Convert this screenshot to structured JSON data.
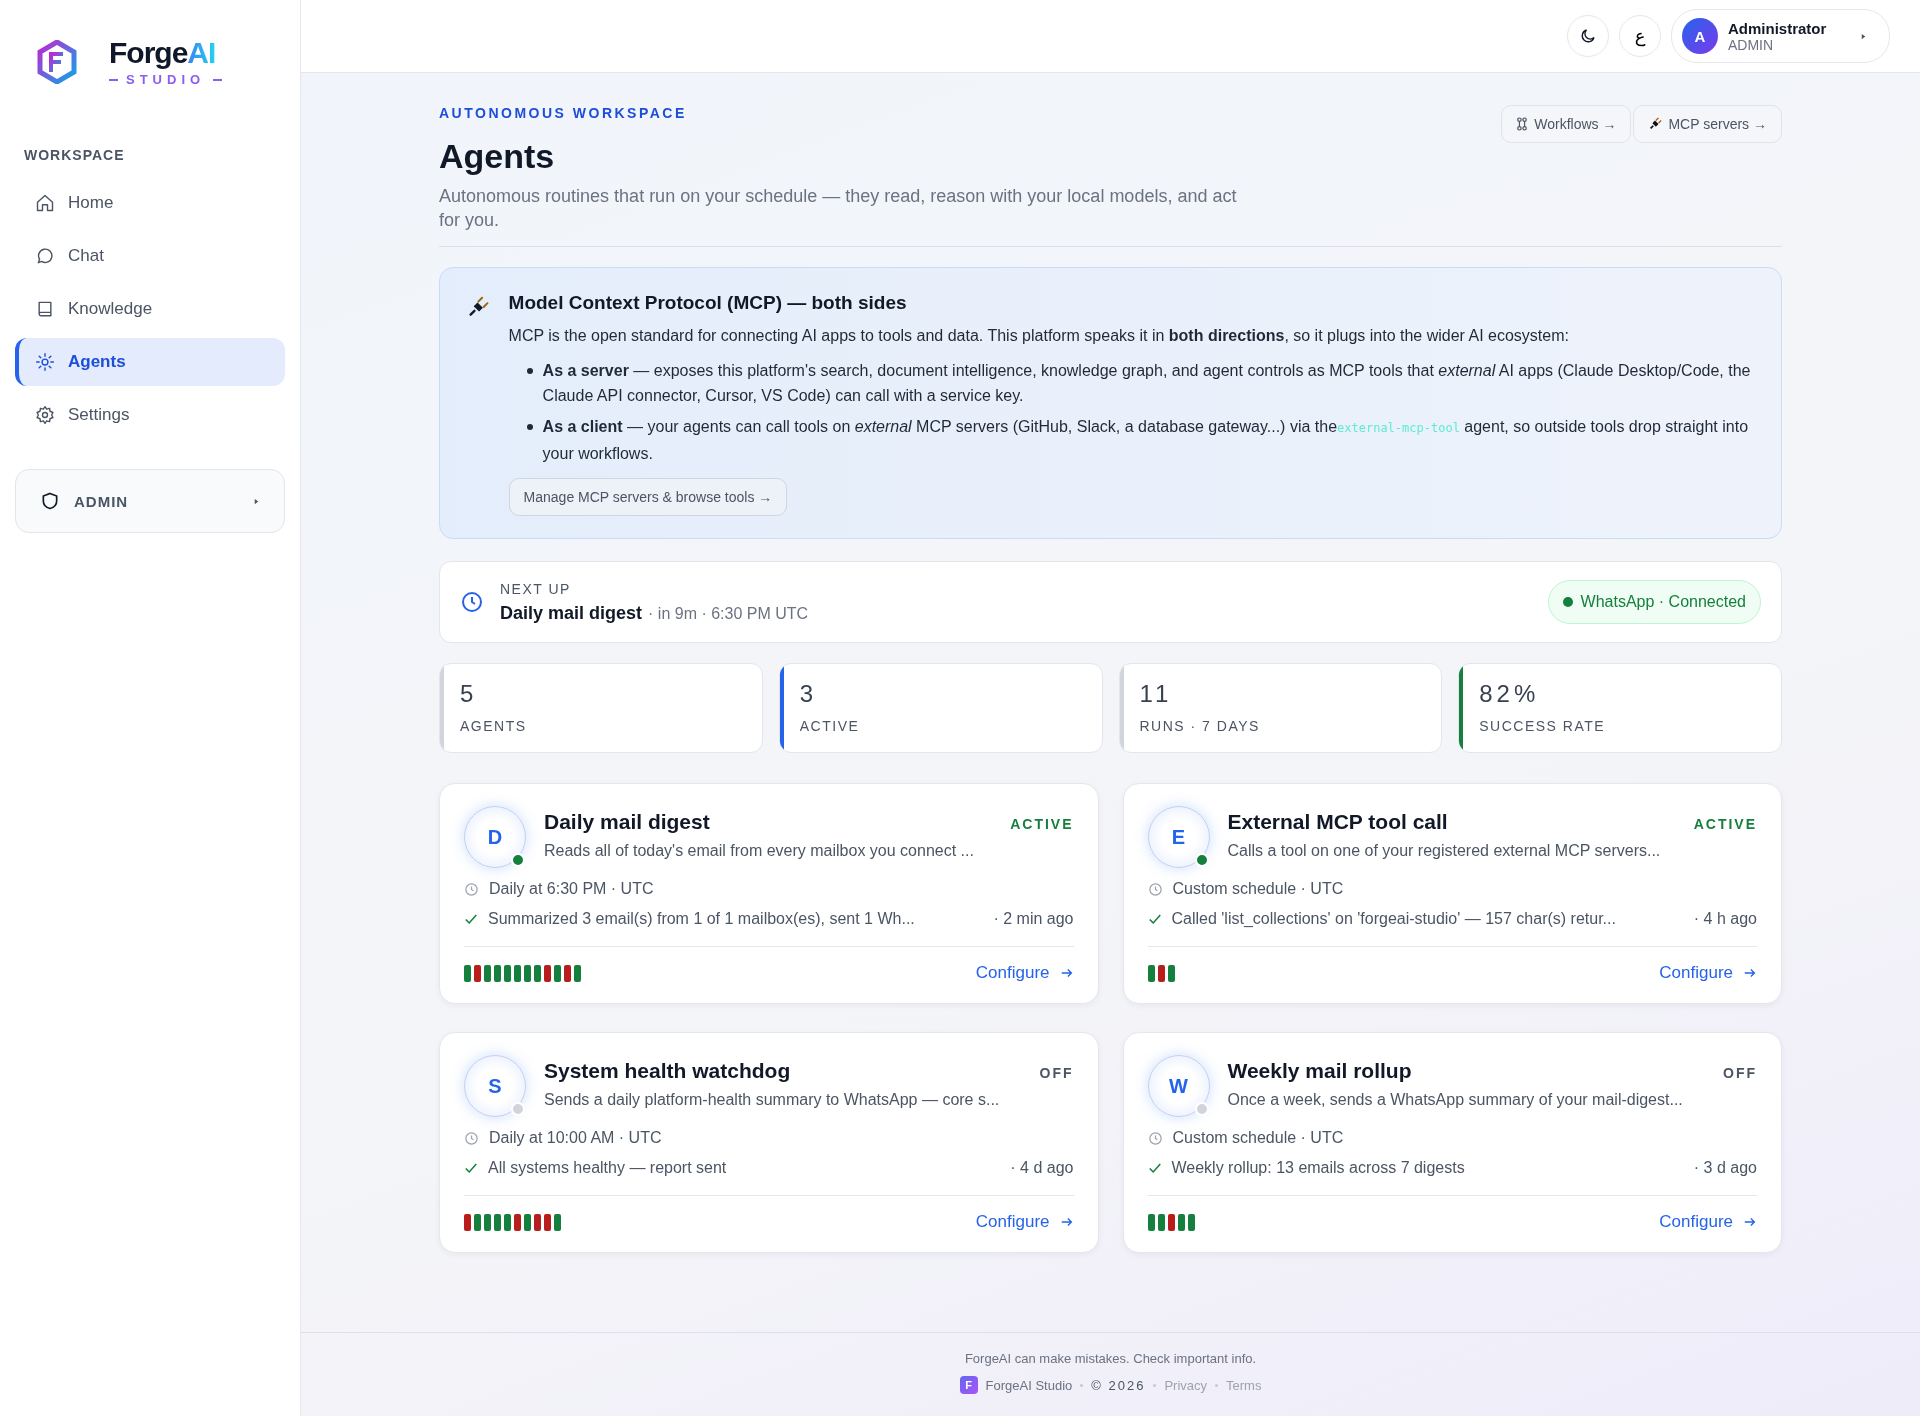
{
  "sidebar": {
    "logo": {
      "name_first": "Forge",
      "name_second": "AI",
      "tagline": "STUDIO"
    },
    "section_label": "WORKSPACE",
    "items": [
      {
        "label": "Home",
        "selected": false
      },
      {
        "label": "Chat",
        "selected": false
      },
      {
        "label": "Knowledge",
        "selected": false
      },
      {
        "label": "Agents",
        "selected": true
      },
      {
        "label": "Settings",
        "selected": false
      }
    ],
    "admin": {
      "label": "ADMIN"
    }
  },
  "topbar": {
    "language_button": "ع",
    "user": {
      "initial": "A",
      "name": "Administrator",
      "role": "ADMIN"
    }
  },
  "header": {
    "eyebrow": "AUTONOMOUS WORKSPACE",
    "title": "Agents",
    "subtitle": "Autonomous routines that run on your schedule — they read, reason with your local models, and act for you.",
    "links": [
      {
        "label": "Workflows →"
      },
      {
        "label": "MCP servers →"
      }
    ]
  },
  "mcp": {
    "title": "Model Context Protocol (MCP) — both sides",
    "intro": "MCP is the open standard for connecting AI apps to tools and data. This platform speaks it in **both directions**, so it plugs into the wider AI ecosystem:",
    "bullets": [
      {
        "text": "**As a server** — exposes this platform's search, document intelligence, knowledge graph, and agent controls as MCP tools that *external* AI apps (Claude Desktop/Code, the Claude API connector, Cursor, VS Code) can call with a service key."
      },
      {
        "text": "**As a client** — your agents can call tools on *external* MCP servers (GitHub, Slack, a database gateway...) via the",
        "code": "external-mcp-tool",
        "after": "agent, so outside tools drop straight into your workflows."
      }
    ],
    "button": "Manage MCP servers & browse tools →"
  },
  "next_up": {
    "label": "NEXT UP",
    "title": "Daily mail digest",
    "detail": "· in 9m · 6:30 PM UTC",
    "status": {
      "label": "WhatsApp · Connected",
      "connected": true
    }
  },
  "stats": [
    {
      "value": "5",
      "label": "AGENTS",
      "color": "#d1d5db"
    },
    {
      "value": "3",
      "label": "ACTIVE",
      "color": "#2563eb"
    },
    {
      "value": "11",
      "label": "RUNS · 7 DAYS",
      "color": "#d1d5db"
    },
    {
      "value": "82%",
      "label": "SUCCESS RATE",
      "color": "#15803d"
    }
  ],
  "agents": [
    {
      "initial": "D",
      "name": "Daily mail digest",
      "status": "ACTIVE",
      "active": true,
      "description": "Reads all of today's email from every mailbox you connect ...",
      "schedule": "Daily at 6:30 PM · UTC",
      "last_run": "Summarized 3 email(s) from 1 of 1 mailbox(es), sent 1 Wh...",
      "last_ago": "· 2 min ago",
      "runs": [
        {
          "ok": true
        },
        {
          "ok": false
        },
        {
          "ok": true
        },
        {
          "ok": true
        },
        {
          "ok": true
        },
        {
          "ok": true
        },
        {
          "ok": true
        },
        {
          "ok": true
        },
        {
          "ok": false
        },
        {
          "ok": true
        },
        {
          "ok": false
        },
        {
          "ok": true
        }
      ],
      "configure": "Configure"
    },
    {
      "initial": "E",
      "name": "External MCP tool call",
      "status": "ACTIVE",
      "active": true,
      "description": "Calls a tool on one of your registered external MCP servers...",
      "schedule": "Custom schedule · UTC",
      "last_run": "Called 'list_collections' on 'forgeai-studio' — 157 char(s) retur...",
      "last_ago": "· 4 h ago",
      "runs": [
        {
          "ok": true
        },
        {
          "ok": false
        },
        {
          "ok": true
        }
      ],
      "configure": "Configure"
    },
    {
      "initial": "S",
      "name": "System health watchdog",
      "status": "OFF",
      "active": false,
      "description": "Sends a daily platform-health summary to WhatsApp — core s...",
      "schedule": "Daily at 10:00 AM · UTC",
      "last_run": "All systems healthy — report sent",
      "last_ago": "· 4 d ago",
      "runs": [
        {
          "ok": false
        },
        {
          "ok": true
        },
        {
          "ok": true
        },
        {
          "ok": true
        },
        {
          "ok": true
        },
        {
          "ok": false
        },
        {
          "ok": true
        },
        {
          "ok": false
        },
        {
          "ok": false
        },
        {
          "ok": true
        }
      ],
      "configure": "Configure"
    },
    {
      "initial": "W",
      "name": "Weekly mail rollup",
      "status": "OFF",
      "active": false,
      "description": "Once a week, sends a WhatsApp summary of your mail-digest...",
      "schedule": "Custom schedule · UTC",
      "last_run": "Weekly rollup: 13 emails across 7 digests",
      "last_ago": "· 3 d ago",
      "runs": [
        {
          "ok": true
        },
        {
          "ok": true
        },
        {
          "ok": false
        },
        {
          "ok": true
        },
        {
          "ok": true
        }
      ],
      "configure": "Configure"
    }
  ],
  "footer": {
    "disclaimer": "ForgeAI can make mistakes. Check important info.",
    "brand_initial": "F",
    "brand": "ForgeAI Studio",
    "copyright": "© 2026",
    "links": [
      {
        "label": "Privacy"
      },
      {
        "label": "Terms"
      }
    ]
  }
}
